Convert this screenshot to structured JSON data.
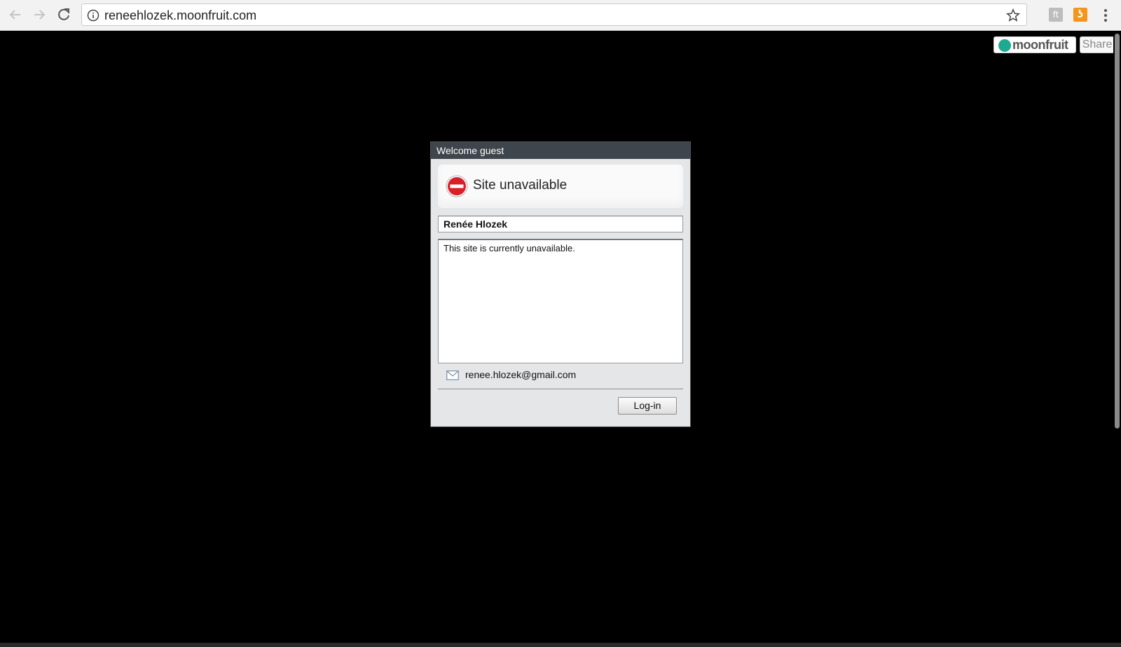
{
  "browser": {
    "url": "reneehlozek.moonfruit.com",
    "extension_1_glyph": "ft",
    "extension_2_glyph": "ʖ"
  },
  "branding": {
    "logo_text": "moonfruit",
    "share_label": "Share",
    "logo_color": "#1eaa91"
  },
  "dialog": {
    "header": "Welcome guest",
    "status_title": "Site unavailable",
    "site_owner": "Renée Hlozek",
    "message": "This site is currently unavailable.",
    "email": "renee.hlozek@gmail.com",
    "login_label": "Log-in",
    "stop_color": "#d9202a"
  },
  "icons": [
    "back-arrow-icon",
    "forward-arrow-icon",
    "reload-icon",
    "info-icon",
    "star-icon",
    "menu-icon",
    "stop-icon",
    "mail-icon"
  ]
}
